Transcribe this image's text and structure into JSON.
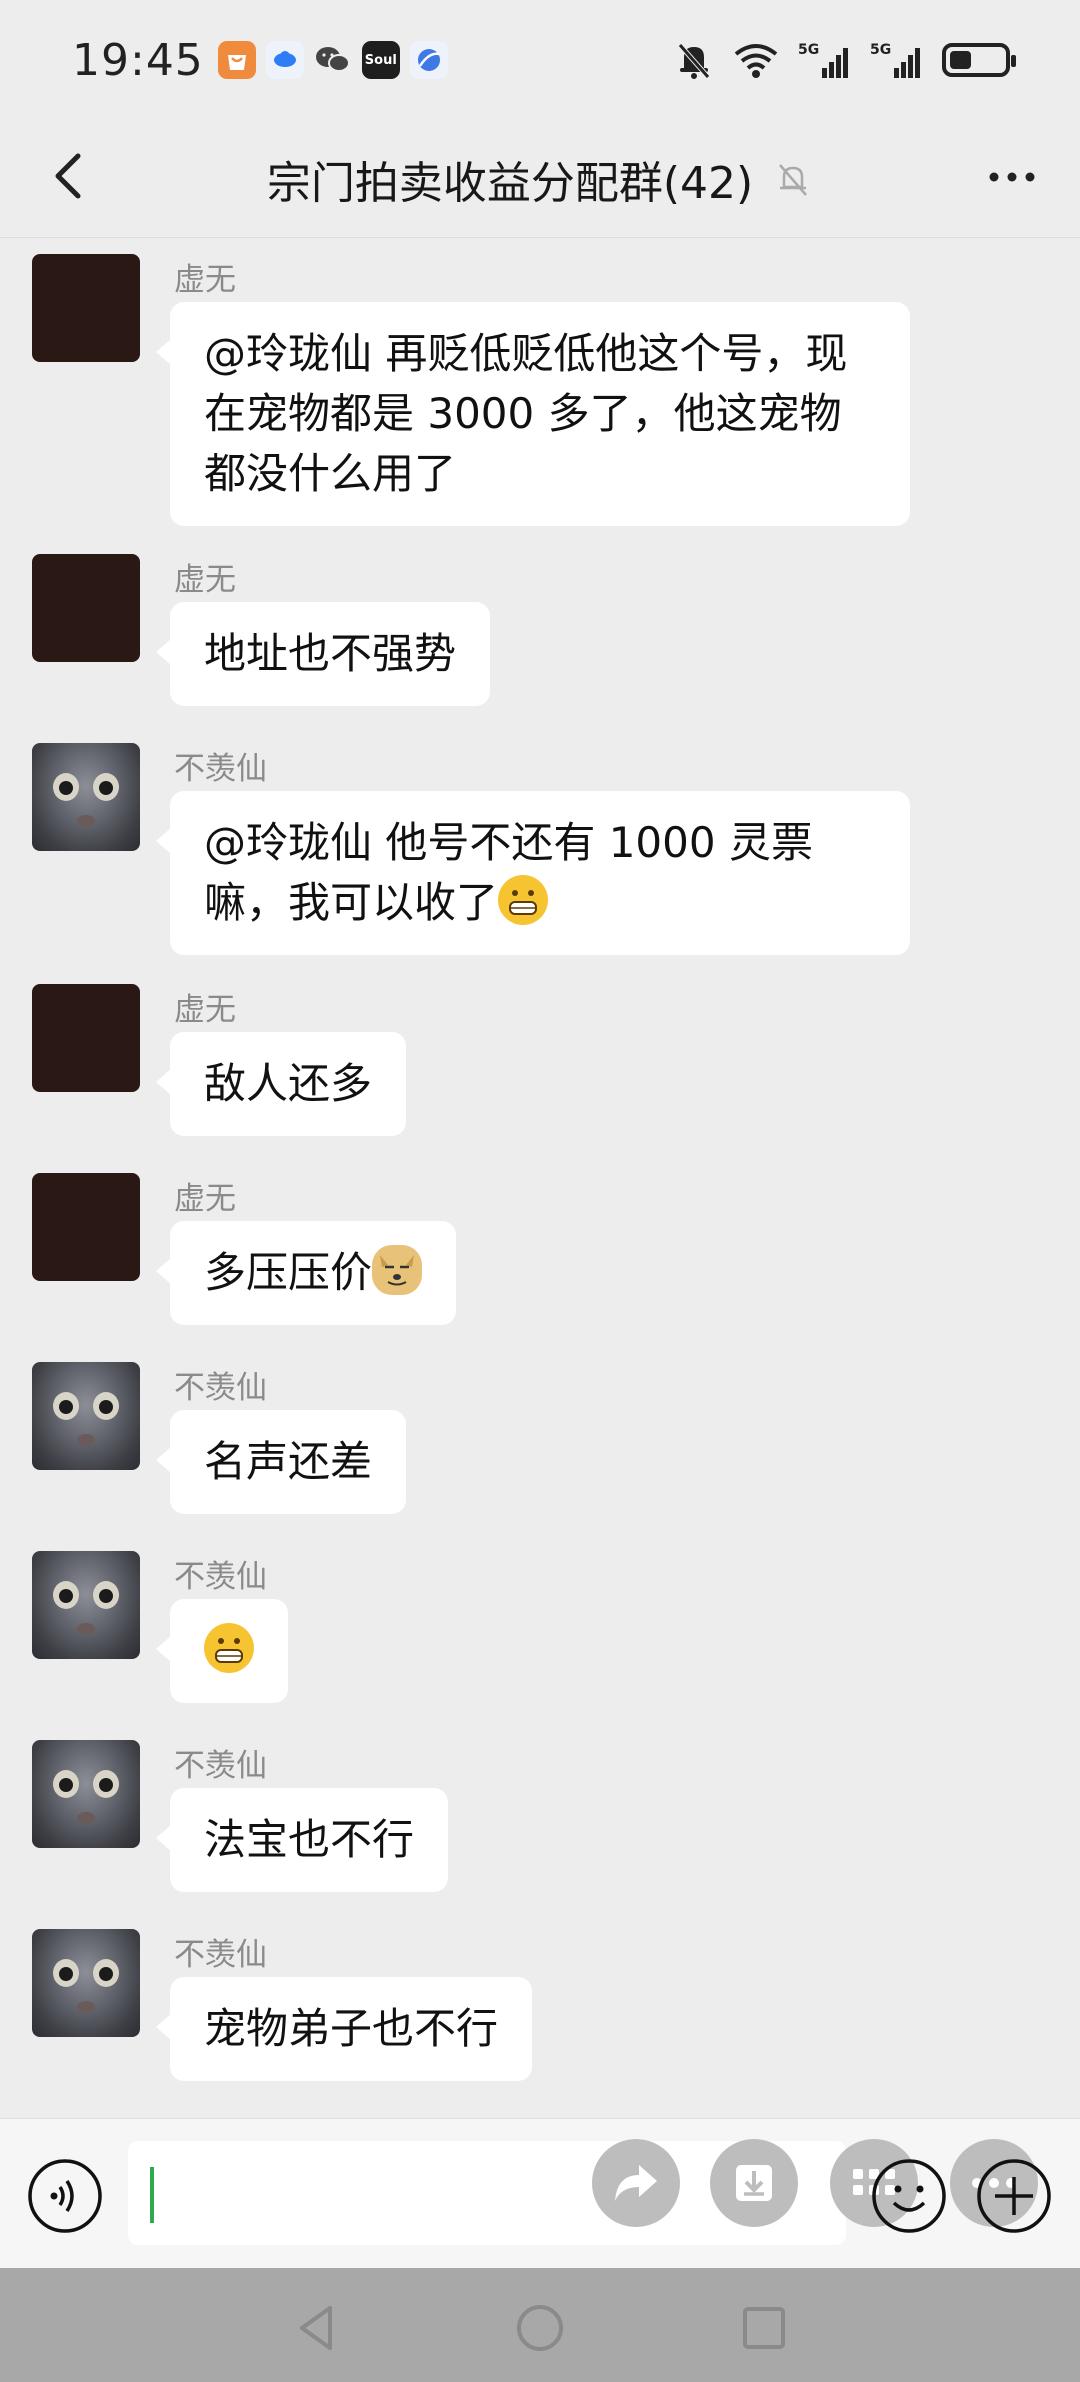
{
  "status_bar": {
    "time": "19:45",
    "app_icons": [
      "shopping-bag-icon",
      "baidu-cloud-icon",
      "wechat-icon",
      "soul-icon",
      "browser-icon"
    ],
    "indicators": [
      "bell-muted-icon",
      "wifi-icon",
      "signal-5g-icon",
      "signal-5g-icon",
      "battery-icon"
    ],
    "soul_label": "Soul"
  },
  "nav": {
    "title": "宗门拍卖收益分配群(42)"
  },
  "messages": [
    {
      "sender": "虚无",
      "avatar": "dark",
      "text": "@玲珑仙  再贬低贬低他这个号，现在宠物都是 3000 多了，他这宠物都没什么用了"
    },
    {
      "sender": "虚无",
      "avatar": "dark",
      "text": "地址也不强势"
    },
    {
      "sender": "不羡仙",
      "avatar": "cat",
      "text": "@玲珑仙  他号不还有 1000 灵票嘛，我可以收了",
      "emoji": "grin-emoji"
    },
    {
      "sender": "虚无",
      "avatar": "dark",
      "text": "敌人还多"
    },
    {
      "sender": "虚无",
      "avatar": "dark",
      "text": "多压压价",
      "emoji": "doge-emoji"
    },
    {
      "sender": "不羡仙",
      "avatar": "cat",
      "text": "名声还差"
    },
    {
      "sender": "不羡仙",
      "avatar": "cat",
      "text": "",
      "emoji": "grin-emoji"
    },
    {
      "sender": "不羡仙",
      "avatar": "cat",
      "text": "法宝也不行"
    },
    {
      "sender": "不羡仙",
      "avatar": "cat",
      "text": "宠物弟子也不行"
    }
  ],
  "input_bar": {
    "value": "",
    "placeholder": ""
  },
  "colors": {
    "background": "#ededed",
    "bubble": "#ffffff",
    "caret": "#2faa4d"
  }
}
